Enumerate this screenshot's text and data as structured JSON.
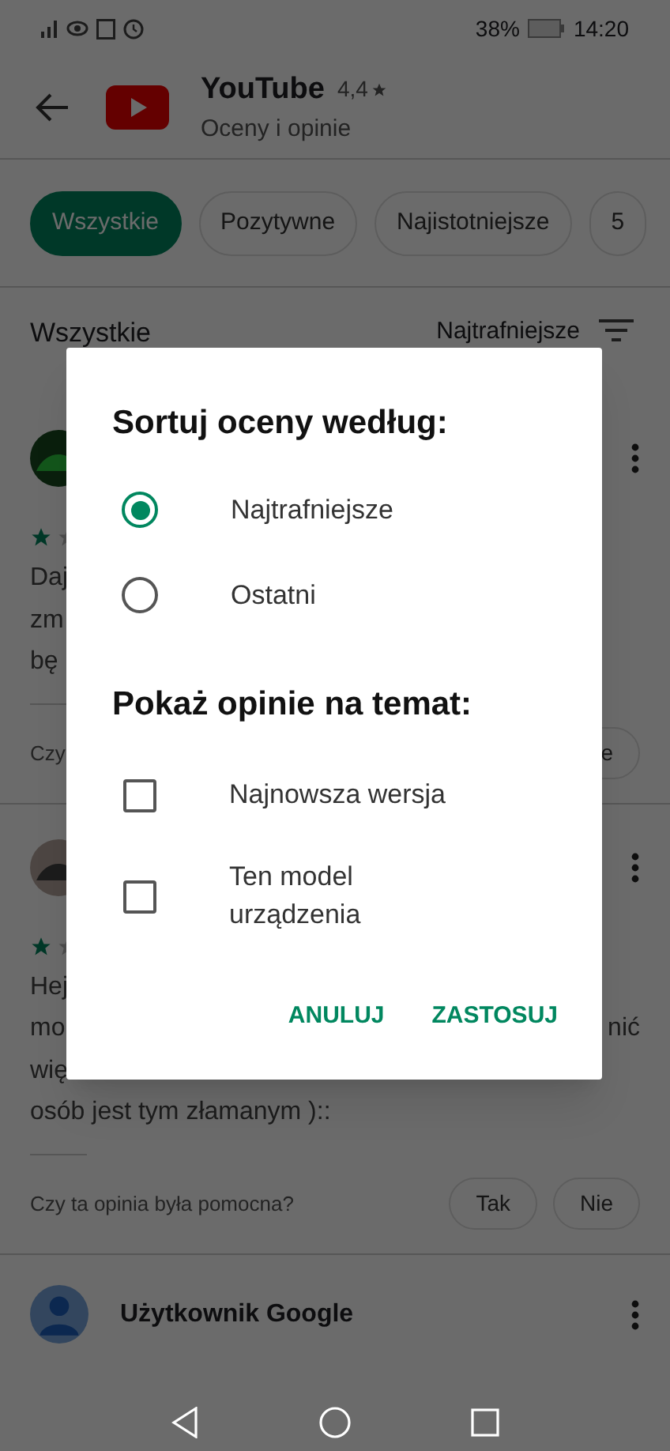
{
  "status_bar": {
    "battery": "38%",
    "time": "14:20"
  },
  "app": {
    "name": "YouTube",
    "rating": "4,4",
    "subtitle": "Oceny i opinie"
  },
  "filter_chips": [
    {
      "label": "Wszystkie",
      "selected": true
    },
    {
      "label": "Pozytywne",
      "selected": false
    },
    {
      "label": "Najistotniejsze",
      "selected": false
    },
    {
      "label": "5",
      "selected": false
    }
  ],
  "list_header": {
    "title": "Wszystkie",
    "sort": "Najtrafniejsze"
  },
  "reviews": [
    {
      "lines": [
        {
          "left": "Daj"
        },
        {
          "left": "zm"
        },
        {
          "left": "bę"
        }
      ],
      "question": "Czy",
      "buttons": [
        "e"
      ]
    },
    {
      "lines": [
        {
          "left": "Hej"
        },
        {
          "left": "mo",
          "right": "nić"
        },
        {
          "left": "wię"
        },
        {
          "left": "osób jest tym złamanym )::"
        }
      ],
      "question": "Czy ta opinia była pomocna?",
      "buttons": [
        "Tak",
        "Nie"
      ]
    }
  ],
  "next_review": {
    "author": "Użytkownik Google"
  },
  "dialog": {
    "title": "Sortuj oceny według:",
    "sort_options": [
      {
        "label": "Najtrafniejsze",
        "selected": true
      },
      {
        "label": "Ostatni",
        "selected": false
      }
    ],
    "filter_title": "Pokaż opinie na temat:",
    "filters": [
      {
        "label": "Najnowsza wersja",
        "checked": false
      },
      {
        "label": "Ten model urządzenia",
        "checked": false
      }
    ],
    "actions": [
      "ANULUJ",
      "ZASTOSUJ"
    ]
  }
}
